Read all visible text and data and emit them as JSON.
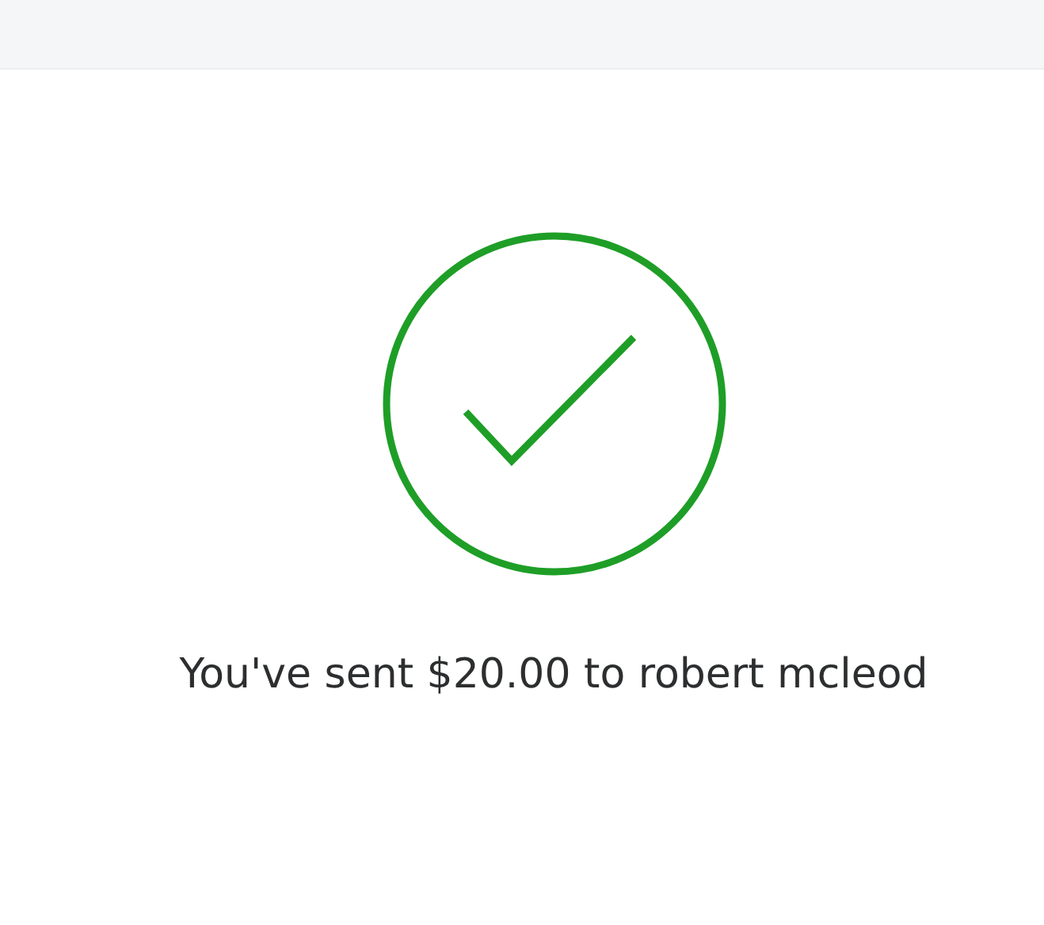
{
  "message": "You've sent $20.00 to robert mcleod"
}
